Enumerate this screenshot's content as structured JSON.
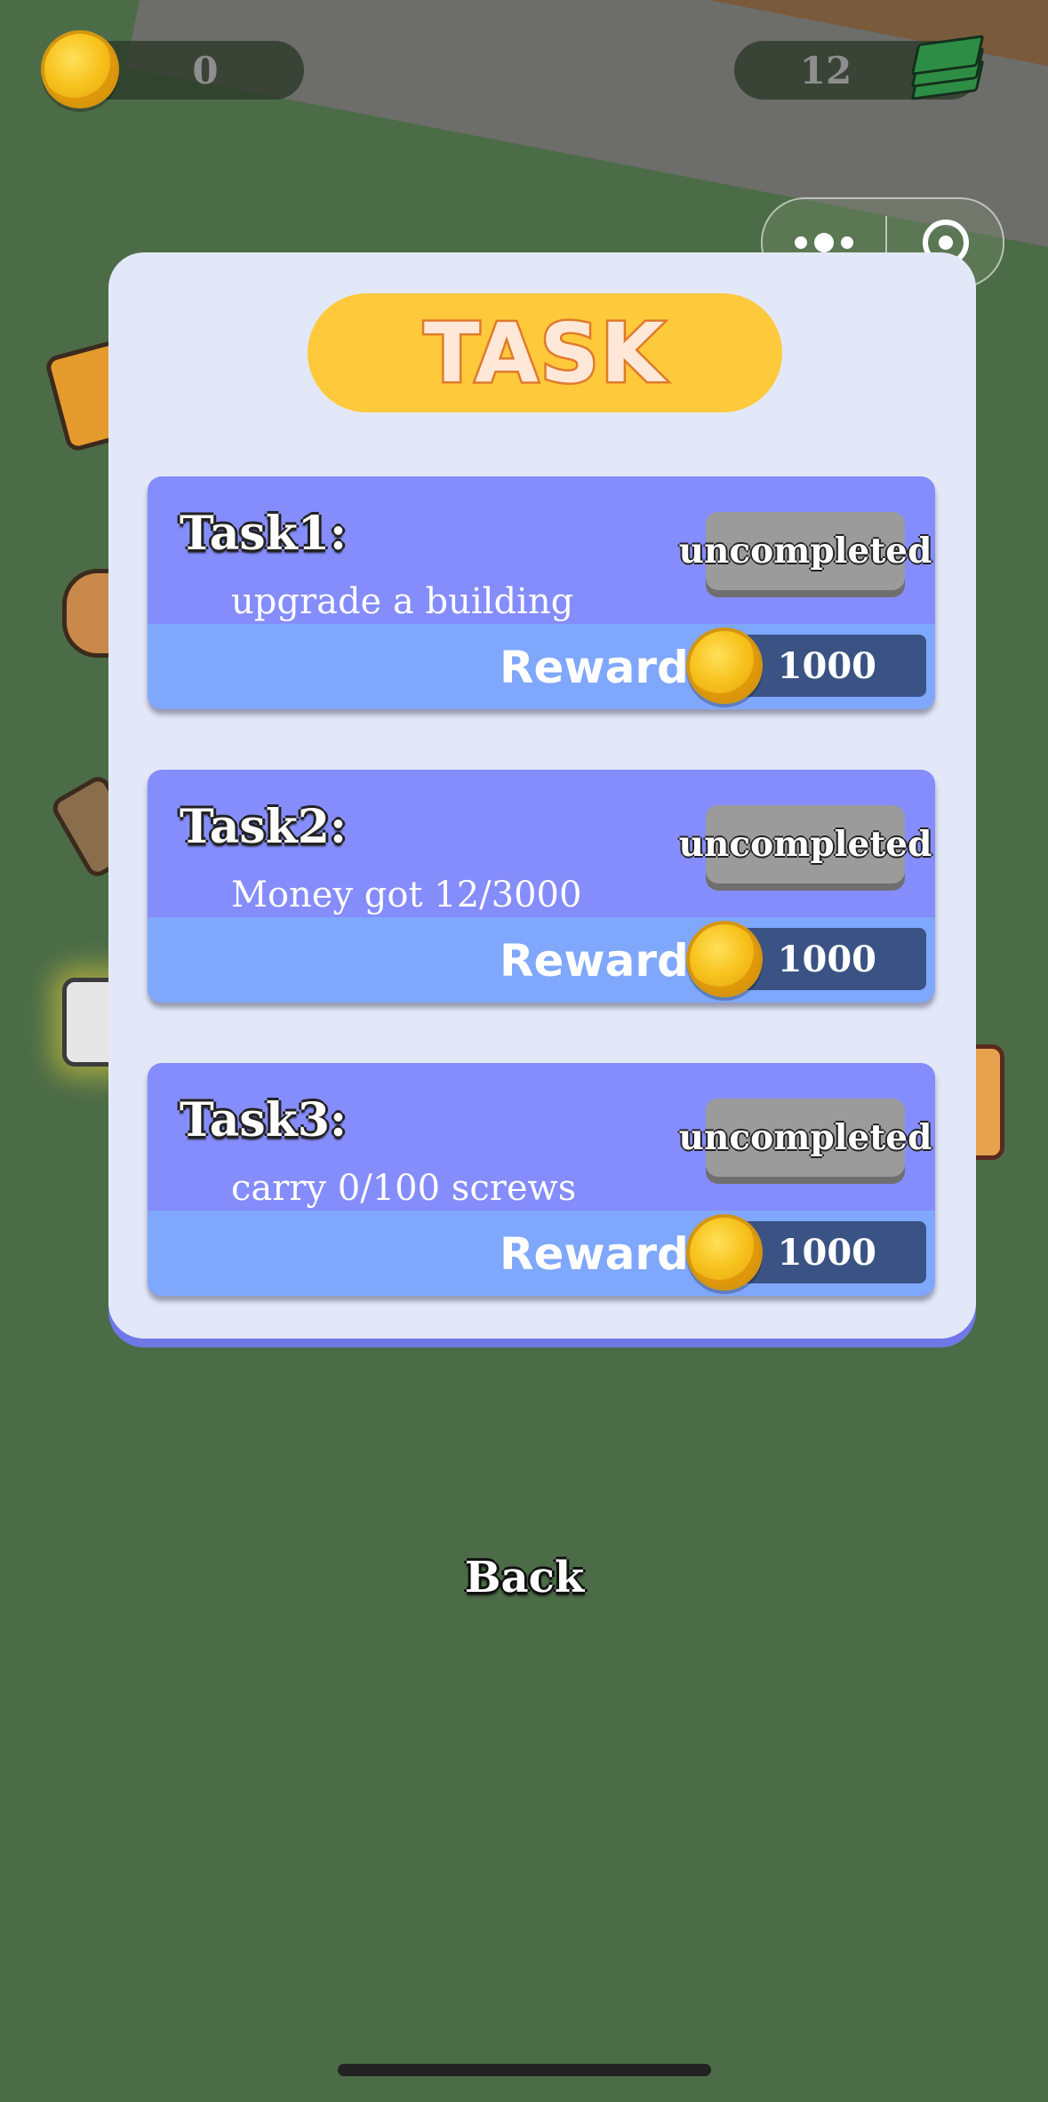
{
  "hud": {
    "coins": "0",
    "cash": "12"
  },
  "panel": {
    "title": "TASK"
  },
  "tasks": [
    {
      "title": "Task1:",
      "description": "upgrade a building",
      "status": "uncompleted",
      "reward_label": "Reward:",
      "reward_value": "1000"
    },
    {
      "title": "Task2:",
      "description": "Money got 12/3000",
      "status": "uncompleted",
      "reward_label": "Reward:",
      "reward_value": "1000"
    },
    {
      "title": "Task3:",
      "description": "carry 0/100 screws",
      "status": "uncompleted",
      "reward_label": "Reward:",
      "reward_value": "1000"
    }
  ],
  "back_label": "Back",
  "colors": {
    "background": "#4c6c47",
    "panel": "#e3e8f8",
    "card": "#858cfb",
    "reward_band": "#7fa7fb",
    "title_pill": "#ffc93c",
    "status_button": "#9b9b9b",
    "reward_box": "#3b5384"
  },
  "icons": {
    "coin": "gold-coin-icon",
    "cash": "cash-stack-icon",
    "menu": "more-dots-icon",
    "close": "target-close-icon"
  }
}
